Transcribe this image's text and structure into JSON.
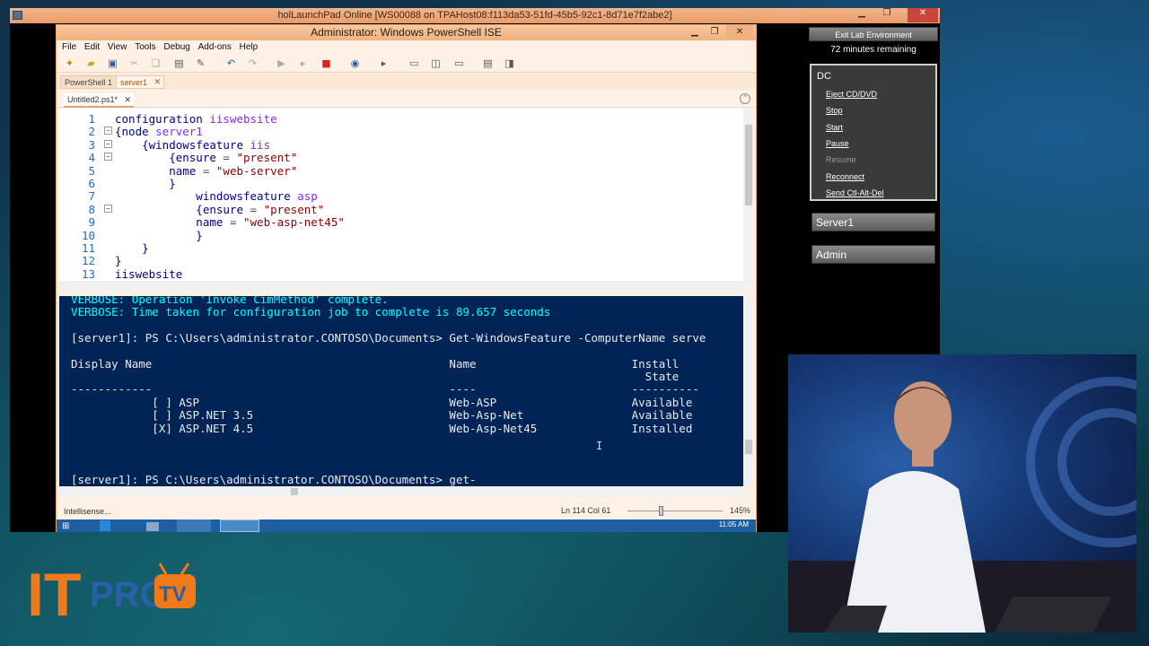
{
  "outer_window": {
    "title": "holLaunchPad Online  [WS00088 on TPAHost08:f113da53-51fd-45b5-92c1-8d71e7f2abe2]"
  },
  "ise": {
    "title": "Administrator: Windows PowerShell ISE",
    "menu": [
      "File",
      "Edit",
      "View",
      "Tools",
      "Debug",
      "Add-ons",
      "Help"
    ],
    "ps_tabs": [
      "PowerShell 1",
      "server1"
    ],
    "file_tab": "Untitled2.ps1*",
    "script_lines": [
      {
        "n": "1",
        "parts": [
          [
            "kw",
            "configuration "
          ],
          [
            "id",
            "iiswebsite"
          ]
        ]
      },
      {
        "n": "2",
        "parts": [
          [
            "kw",
            "{node "
          ],
          [
            "id",
            "server1"
          ]
        ]
      },
      {
        "n": "3",
        "parts": [
          [
            "kw",
            "    {windowsfeature "
          ],
          [
            "id",
            "iis"
          ]
        ]
      },
      {
        "n": "4",
        "parts": [
          [
            "kw",
            "        {ensure "
          ],
          [
            "op",
            "= "
          ],
          [
            "str",
            "\"present\""
          ]
        ]
      },
      {
        "n": "5",
        "parts": [
          [
            "kw",
            "        name "
          ],
          [
            "op",
            "= "
          ],
          [
            "str",
            "\"web-server\""
          ]
        ]
      },
      {
        "n": "6",
        "parts": [
          [
            "kw",
            "        }"
          ]
        ]
      },
      {
        "n": "7",
        "parts": [
          [
            "kw",
            "            windowsfeature "
          ],
          [
            "id",
            "asp"
          ]
        ]
      },
      {
        "n": "8",
        "parts": [
          [
            "kw",
            "            {ensure "
          ],
          [
            "op",
            "= "
          ],
          [
            "str",
            "\"present\""
          ]
        ]
      },
      {
        "n": "9",
        "parts": [
          [
            "kw",
            "            name "
          ],
          [
            "op",
            "= "
          ],
          [
            "str",
            "\"web-asp-net45\""
          ]
        ]
      },
      {
        "n": "10",
        "parts": [
          [
            "kw",
            "            }"
          ]
        ]
      },
      {
        "n": "11",
        "parts": [
          [
            "kw",
            "    }"
          ]
        ]
      },
      {
        "n": "12",
        "parts": [
          [
            "kw",
            "}"
          ]
        ]
      },
      {
        "n": "13",
        "parts": [
          [
            "kw",
            "iiswebsite"
          ]
        ]
      }
    ],
    "console_lines": [
      {
        "cls": "verbose",
        "text": "VERBOSE: Operation 'Invoke CimMethod' complete."
      },
      {
        "cls": "verbose",
        "text": "VERBOSE: Time taken for configuration job to complete is 89.657 seconds"
      },
      {
        "cls": "",
        "text": ""
      },
      {
        "cls": "",
        "text": "[server1]: PS C:\\Users\\administrator.CONTOSO\\Documents> Get-WindowsFeature -ComputerName serve"
      },
      {
        "cls": "",
        "text": ""
      },
      {
        "cls": "",
        "text": "Display Name                                            Name                       Install"
      },
      {
        "cls": "",
        "text": "                                                                                     State"
      },
      {
        "cls": "",
        "text": "------------                                            ----                       ----------"
      },
      {
        "cls": "",
        "text": "            [ ] ASP                                     Web-ASP                    Available"
      },
      {
        "cls": "",
        "text": "            [ ] ASP.NET 3.5                             Web-Asp-Net                Available"
      },
      {
        "cls": "",
        "text": "            [X] ASP.NET 4.5                             Web-Asp-Net45              Installed"
      },
      {
        "cls": "",
        "text": ""
      },
      {
        "cls": "",
        "text": ""
      },
      {
        "cls": "",
        "text": ""
      },
      {
        "cls": "",
        "text": "[server1]: PS C:\\Users\\administrator.CONTOSO\\Documents> get-"
      }
    ],
    "status": {
      "left": "Intellisense...",
      "position": "Ln 114  Col 61",
      "zoom": "145%",
      "zoom_level": 0.35
    },
    "taskbar_time": "11:05 AM"
  },
  "lab_panel": {
    "exit_label": "Exit Lab Environment",
    "time_remaining": "72 minutes remaining",
    "dc": {
      "title": "DC",
      "actions": [
        {
          "label": "Eject CD/DVD",
          "enabled": true
        },
        {
          "label": "Stop",
          "enabled": true
        },
        {
          "label": "Start",
          "enabled": true
        },
        {
          "label": "Pause",
          "enabled": true
        },
        {
          "label": "Resume",
          "enabled": false
        },
        {
          "label": "Reconnect",
          "enabled": true
        },
        {
          "label": "Send Ctl-Alt-Del",
          "enabled": true
        }
      ]
    },
    "vms": [
      "Server1",
      "Admin"
    ]
  },
  "logo": {
    "it": "IT",
    "pro": "PRO",
    "tv": "TV"
  },
  "colors": {
    "console_bg": "#012456",
    "verbose": "#00ffff",
    "logo_orange": "#f07a1a",
    "logo_blue": "#2b5fa8"
  }
}
